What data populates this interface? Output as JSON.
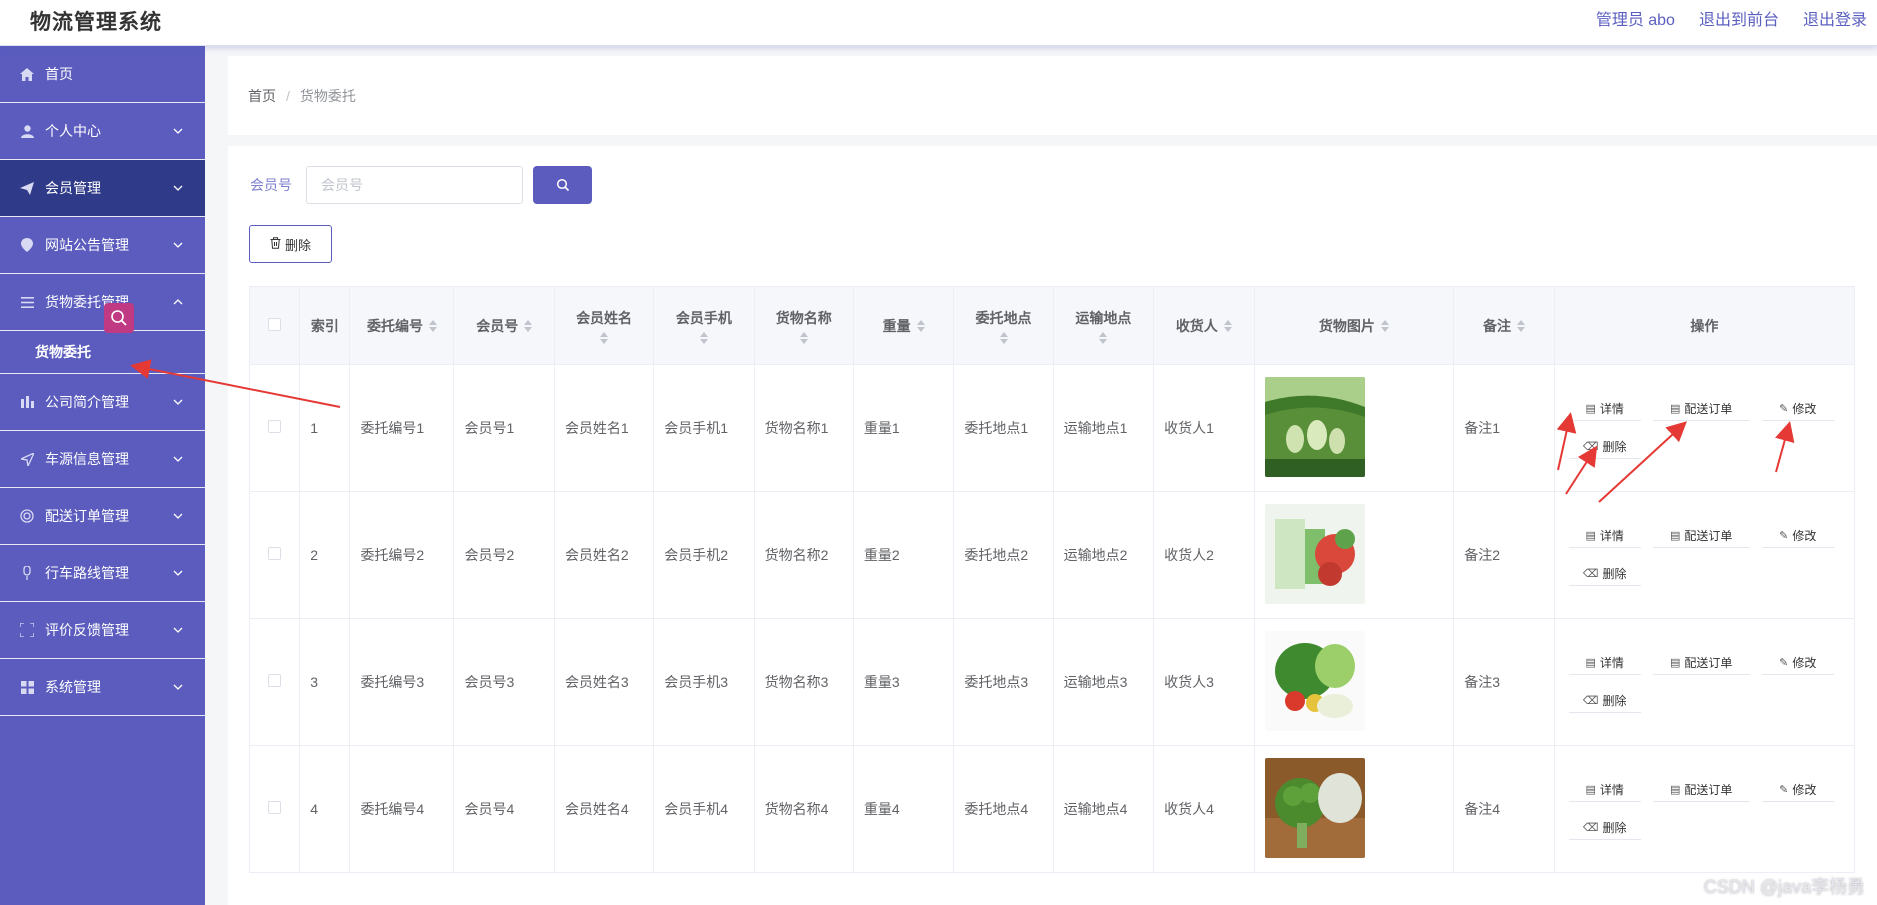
{
  "header": {
    "app_title": "物流管理系统",
    "links": [
      "管理员 abo",
      "退出到前台",
      "退出登录"
    ]
  },
  "sidebar": {
    "items": [
      {
        "label": "首页",
        "icon": "home-icon",
        "has_chevron": false,
        "active": false
      },
      {
        "label": "个人中心",
        "icon": "user-icon",
        "has_chevron": true,
        "active": false
      },
      {
        "label": "会员管理",
        "icon": "send-icon",
        "has_chevron": true,
        "active": true
      },
      {
        "label": "网站公告管理",
        "icon": "location-icon",
        "has_chevron": true,
        "active": false
      },
      {
        "label": "货物委托管理",
        "icon": "menu-icon",
        "has_chevron": true,
        "expanded": true,
        "submenu": [
          "货物委托"
        ]
      },
      {
        "label": "公司简介管理",
        "icon": "chart-icon",
        "has_chevron": true,
        "active": false
      },
      {
        "label": "车源信息管理",
        "icon": "navigation-icon",
        "has_chevron": true,
        "active": false
      },
      {
        "label": "配送订单管理",
        "icon": "target-icon",
        "has_chevron": true,
        "active": false
      },
      {
        "label": "行车路线管理",
        "icon": "mic-icon",
        "has_chevron": true,
        "active": false
      },
      {
        "label": "评价反馈管理",
        "icon": "scan-icon",
        "has_chevron": true,
        "active": false
      },
      {
        "label": "系统管理",
        "icon": "grid-icon",
        "has_chevron": true,
        "active": false
      }
    ]
  },
  "breadcrumb": {
    "home": "首页",
    "separator": "/",
    "current": "货物委托"
  },
  "search": {
    "label": "会员号",
    "placeholder": "会员号",
    "value": ""
  },
  "toolbar": {
    "delete_label": "删除"
  },
  "table": {
    "headers": [
      "索引",
      "委托编号",
      "会员号",
      "会员姓名",
      "会员手机",
      "货物名称",
      "重量",
      "委托地点",
      "运输地点",
      "收货人",
      "货物图片",
      "备注",
      "操作"
    ],
    "rows": [
      {
        "index": "1",
        "cells": [
          "委托编号1",
          "会员号1",
          "会员姓名1",
          "会员手机1",
          "货物名称1",
          "重量1",
          "委托地点1",
          "运输地点1",
          "收货人1"
        ],
        "remark": "备注1",
        "image": "gourds"
      },
      {
        "index": "2",
        "cells": [
          "委托编号2",
          "会员号2",
          "会员姓名2",
          "会员手机2",
          "货物名称2",
          "重量2",
          "委托地点2",
          "运输地点2",
          "收货人2"
        ],
        "remark": "备注2",
        "image": "vegetables-blur"
      },
      {
        "index": "3",
        "cells": [
          "委托编号3",
          "会员号3",
          "会员姓名3",
          "会员手机3",
          "货物名称3",
          "重量3",
          "委托地点3",
          "运输地点3",
          "收货人3"
        ],
        "remark": "备注3",
        "image": "greens"
      },
      {
        "index": "4",
        "cells": [
          "委托编号4",
          "会员号4",
          "会员姓名4",
          "会员手机4",
          "货物名称4",
          "重量4",
          "委托地点4",
          "运输地点4",
          "收货人4"
        ],
        "remark": "备注4",
        "image": "broccoli"
      }
    ],
    "actions": [
      "详情",
      "配送订单",
      "修改",
      "删除"
    ]
  },
  "watermark": "CSDN @java李杨勇",
  "colors": {
    "primary": "#5b5cbe",
    "active_menu": "#2f3a88",
    "annotation": "#e53935"
  }
}
